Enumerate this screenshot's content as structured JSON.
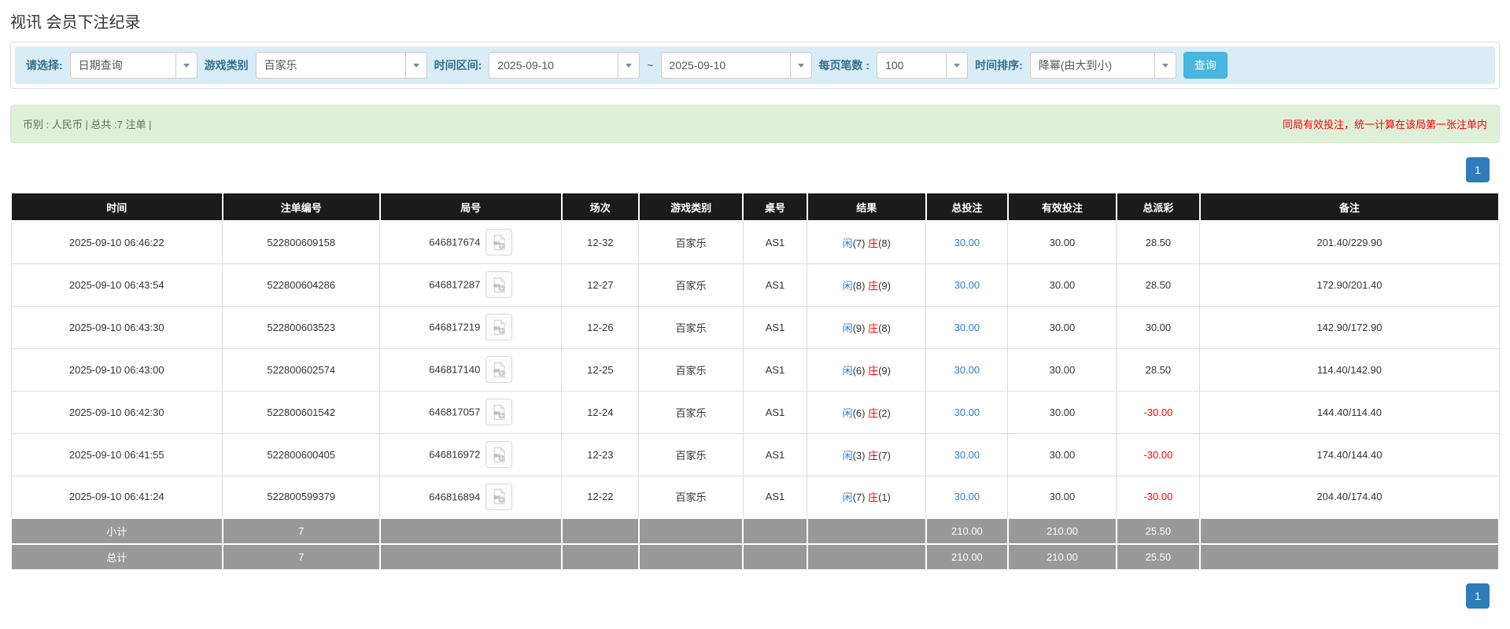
{
  "page": {
    "title": "视讯 会员下注纪录"
  },
  "filters": {
    "select_label": "请选择:",
    "select_value": "日期查询",
    "game_type_label": "游戏类别",
    "game_type_value": "百家乐",
    "time_range_label": "时间区间:",
    "date_from": "2025-09-10",
    "tilde": "~",
    "date_to": "2025-09-10",
    "page_size_label": "每页笔数 :",
    "page_size_value": "100",
    "sort_label": "时间排序:",
    "sort_value": "降幂(由大到小)",
    "search_button": "查询"
  },
  "summary": {
    "left": "币别 : 人民币 | 总共 :7 注单 |",
    "right_notice": "同局有效投注，统一计算在该局第一张注单内"
  },
  "pagination": {
    "page": "1"
  },
  "icons": {
    "dropdown_arrow": "chevron-down-icon",
    "round_video": "video-file-icon"
  },
  "colors": {
    "header_bg": "#1b1b1b",
    "filter_bar_bg": "#d9edf7",
    "summary_bg": "#dff0d8",
    "search_button_bg": "#49b6df",
    "pager_bg": "#2e7cb8",
    "link_blue": "#2d7cd6",
    "negative_red": "#ff0000",
    "footer_bg": "#999999"
  },
  "table": {
    "headers": [
      "时间",
      "注单编号",
      "局号",
      "场次",
      "游戏类别",
      "桌号",
      "结果",
      "总投注",
      "有效投注",
      "总派彩",
      "备注"
    ],
    "rows": [
      {
        "time": "2025-09-10 06:46:22",
        "bet_id": "522800609158",
        "round_id": "646817674",
        "session": "12-32",
        "game": "百家乐",
        "table_no": "AS1",
        "result_player_label": "闲",
        "result_player_num": "(7)",
        "result_banker_label": "庄",
        "result_banker_num": "(8)",
        "total_bet": "30.00",
        "valid_bet": "30.00",
        "payout": "28.50",
        "remark": "201.40/229.90"
      },
      {
        "time": "2025-09-10 06:43:54",
        "bet_id": "522800604286",
        "round_id": "646817287",
        "session": "12-27",
        "game": "百家乐",
        "table_no": "AS1",
        "result_player_label": "闲",
        "result_player_num": "(8)",
        "result_banker_label": "庄",
        "result_banker_num": "(9)",
        "total_bet": "30.00",
        "valid_bet": "30.00",
        "payout": "28.50",
        "remark": "172.90/201.40"
      },
      {
        "time": "2025-09-10 06:43:30",
        "bet_id": "522800603523",
        "round_id": "646817219",
        "session": "12-26",
        "game": "百家乐",
        "table_no": "AS1",
        "result_player_label": "闲",
        "result_player_num": "(9)",
        "result_banker_label": "庄",
        "result_banker_num": "(8)",
        "total_bet": "30.00",
        "valid_bet": "30.00",
        "payout": "30.00",
        "remark": "142.90/172.90"
      },
      {
        "time": "2025-09-10 06:43:00",
        "bet_id": "522800602574",
        "round_id": "646817140",
        "session": "12-25",
        "game": "百家乐",
        "table_no": "AS1",
        "result_player_label": "闲",
        "result_player_num": "(6)",
        "result_banker_label": "庄",
        "result_banker_num": "(9)",
        "total_bet": "30.00",
        "valid_bet": "30.00",
        "payout": "28.50",
        "remark": "114.40/142.90"
      },
      {
        "time": "2025-09-10 06:42:30",
        "bet_id": "522800601542",
        "round_id": "646817057",
        "session": "12-24",
        "game": "百家乐",
        "table_no": "AS1",
        "result_player_label": "闲",
        "result_player_num": "(6)",
        "result_banker_label": "庄",
        "result_banker_num": "(2)",
        "total_bet": "30.00",
        "valid_bet": "30.00",
        "payout": "-30.00",
        "remark": "144.40/114.40"
      },
      {
        "time": "2025-09-10 06:41:55",
        "bet_id": "522800600405",
        "round_id": "646816972",
        "session": "12-23",
        "game": "百家乐",
        "table_no": "AS1",
        "result_player_label": "闲",
        "result_player_num": "(3)",
        "result_banker_label": "庄",
        "result_banker_num": "(7)",
        "total_bet": "30.00",
        "valid_bet": "30.00",
        "payout": "-30.00",
        "remark": "174.40/144.40"
      },
      {
        "time": "2025-09-10 06:41:24",
        "bet_id": "522800599379",
        "round_id": "646816894",
        "session": "12-22",
        "game": "百家乐",
        "table_no": "AS1",
        "result_player_label": "闲",
        "result_player_num": "(7)",
        "result_banker_label": "庄",
        "result_banker_num": "(1)",
        "total_bet": "30.00",
        "valid_bet": "30.00",
        "payout": "-30.00",
        "remark": "204.40/174.40"
      }
    ],
    "subtotal": {
      "label": "小计",
      "count": "7",
      "total_bet": "210.00",
      "valid_bet": "210.00",
      "payout": "25.50"
    },
    "total": {
      "label": "总计",
      "count": "7",
      "total_bet": "210.00",
      "valid_bet": "210.00",
      "payout": "25.50"
    }
  }
}
